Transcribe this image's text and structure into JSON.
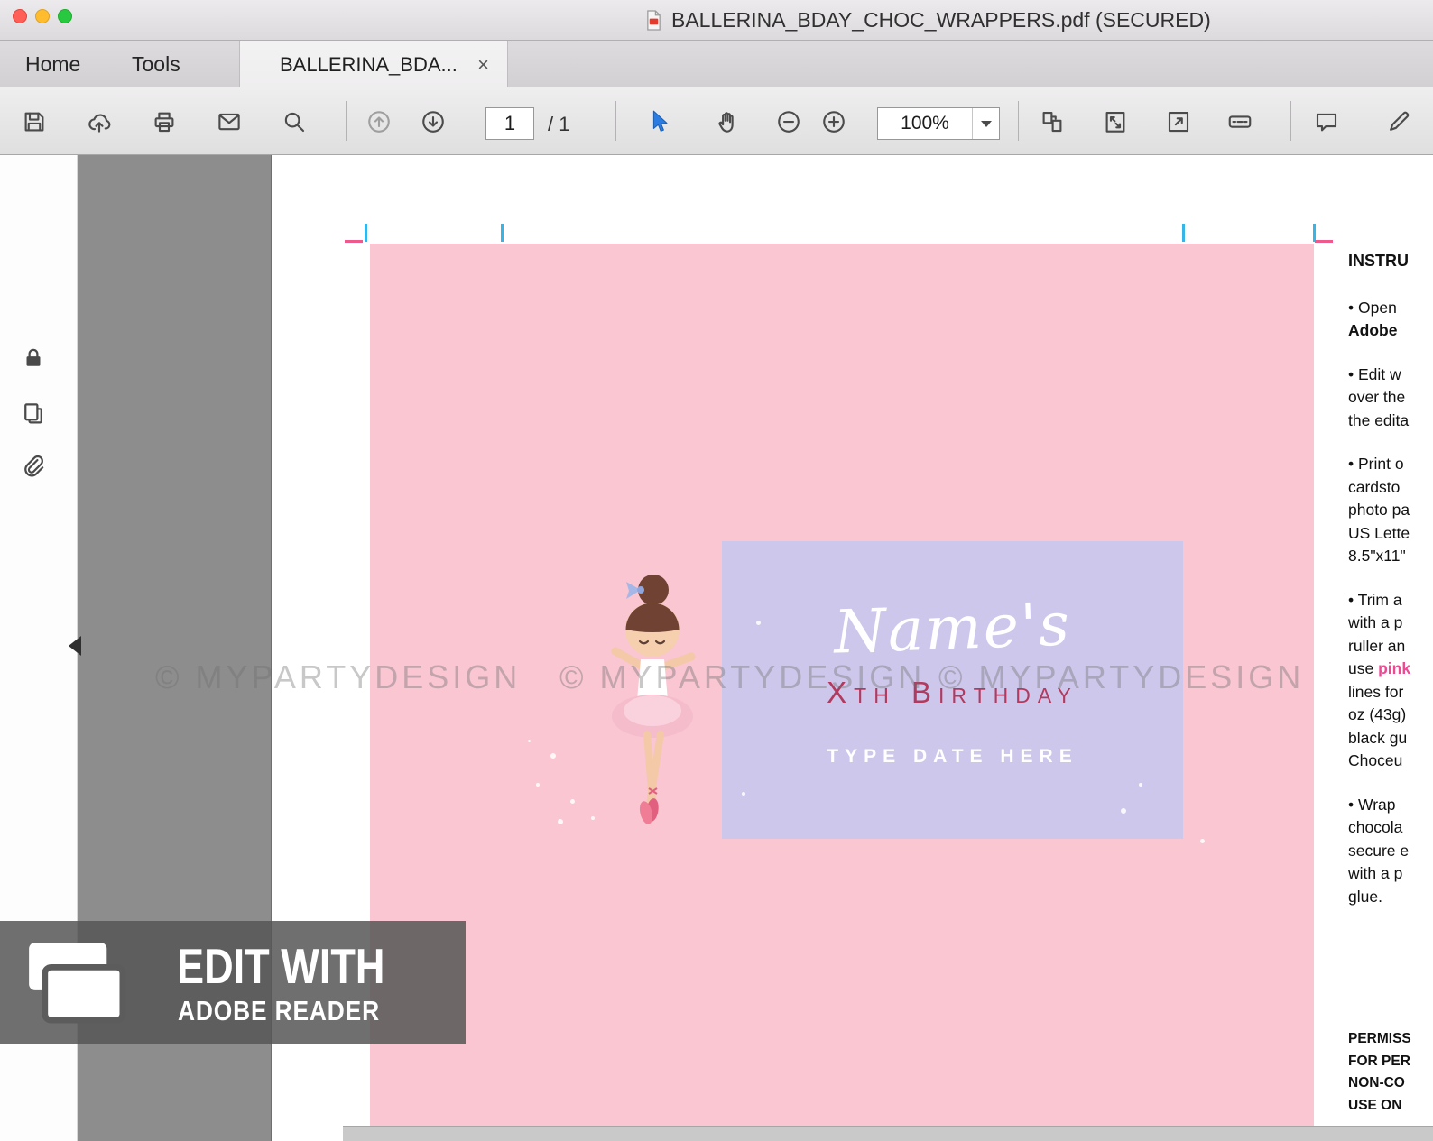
{
  "window": {
    "title": "BALLERINA_BDAY_CHOC_WRAPPERS.pdf (SECURED)"
  },
  "tabs": {
    "home": "Home",
    "tools": "Tools",
    "document": "BALLERINA_BDA...",
    "close": "×"
  },
  "toolbar": {
    "page_current": "1",
    "page_total": "/ 1",
    "zoom_level": "100%",
    "icons": [
      "save-icon",
      "cloud-upload-icon",
      "printer-icon",
      "envelope-icon",
      "search-icon",
      "page-up-icon",
      "page-down-icon",
      "cursor-icon",
      "hand-icon",
      "zoom-out-icon",
      "zoom-in-icon",
      "page-view-icon",
      "fit-page-icon",
      "fullscreen-icon",
      "read-mode-icon",
      "comment-icon",
      "sign-pen-icon"
    ]
  },
  "sidebar": {
    "icons": [
      "lock-icon",
      "pages-icon",
      "paperclip-icon"
    ]
  },
  "document": {
    "watermark": "© MYPARTYDESIGN",
    "wrapper": {
      "name_text": "Name's",
      "birthday_text": "Xth Birthday",
      "date_text": "TYPE DATE HERE"
    },
    "instructions": {
      "title": "INSTRU",
      "lines": [
        "• Open",
        "Adobe",
        "• Edit w",
        "over the",
        "the edita",
        "• Print o",
        "cardsto",
        "photo pa",
        "US Lette",
        "8.5\"x11\"",
        "• Trim a",
        "with a p",
        "ruller an",
        "lines for",
        "oz (43g)",
        "black gu",
        "Choceu",
        "• Wrap",
        "chocola",
        "secure e",
        "with a p",
        "glue."
      ],
      "use_prefix": "use ",
      "pink_word": "pink",
      "footer": [
        "PERMISS",
        "FOR PER",
        "NON-CO",
        "USE ON"
      ]
    }
  },
  "overlay": {
    "title": "EDIT WITH",
    "subtitle": "ADOBE READER"
  },
  "colors": {
    "pink-bg": "#f9c6d2",
    "lavender": "#cdc7eb",
    "birthday-text": "#b23a5f",
    "pink-accent": "#ed4a94",
    "crop-blue": "#36b5e6",
    "crop-pink": "#ef5a8c",
    "canvas-grey": "#8d8d8d"
  }
}
